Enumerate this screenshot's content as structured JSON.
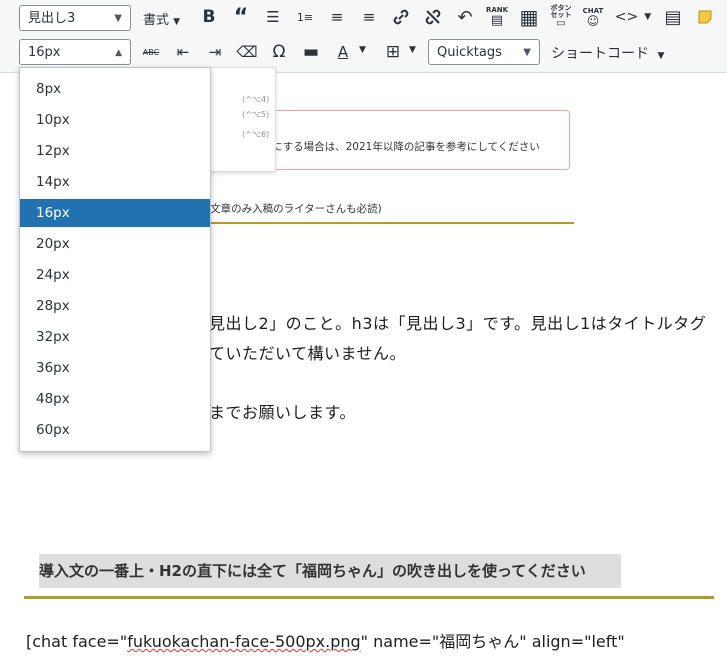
{
  "toolbar": {
    "heading_select": "見出し3",
    "format_label": "書式",
    "fontsize_select": "16px",
    "rank_label": "RANK",
    "button_set_label": "ボタン セット",
    "chat_label": "CHAT",
    "quicktags_select": "Quicktags",
    "shortcode_label": "ショートコード",
    "strike_label": "ABC",
    "omega_label": "Ω",
    "text_color_label": "A"
  },
  "font_size_dropdown": {
    "options": [
      "8px",
      "10px",
      "12px",
      "14px",
      "16px",
      "20px",
      "24px",
      "28px",
      "32px",
      "36px",
      "48px",
      "60px"
    ],
    "selected": "16px"
  },
  "background_menu_shortcuts": [
    "(^⌥4)",
    "(^⌥5)",
    "(^⌥6)"
  ],
  "editor": {
    "notice_text": "にする場合は、2021年以降の記事を参考にしてください",
    "caption_text": "(文章のみ入稿のライターさんも必読)",
    "para1_line1": "見出し2」のこと。h3は「見出し3」です。見出し1はタイトルタグ",
    "para1_line2": "ていただいて構いません。",
    "para2": "までお願いします。",
    "highlight_heading": "導入文の一番上・H2の直下には全て「福岡ちゃん」の吹き出しを使ってください",
    "chat_prefix": "[chat face=\"",
    "chat_face": "fukuokachan-face-500px.png",
    "chat_suffix": "\" name=\"福岡ちゃん\" align=\"left\""
  },
  "colors": {
    "selected": "#2271b1",
    "gold_rule": "#b39a2e",
    "notice_border": "#e8a79a"
  }
}
